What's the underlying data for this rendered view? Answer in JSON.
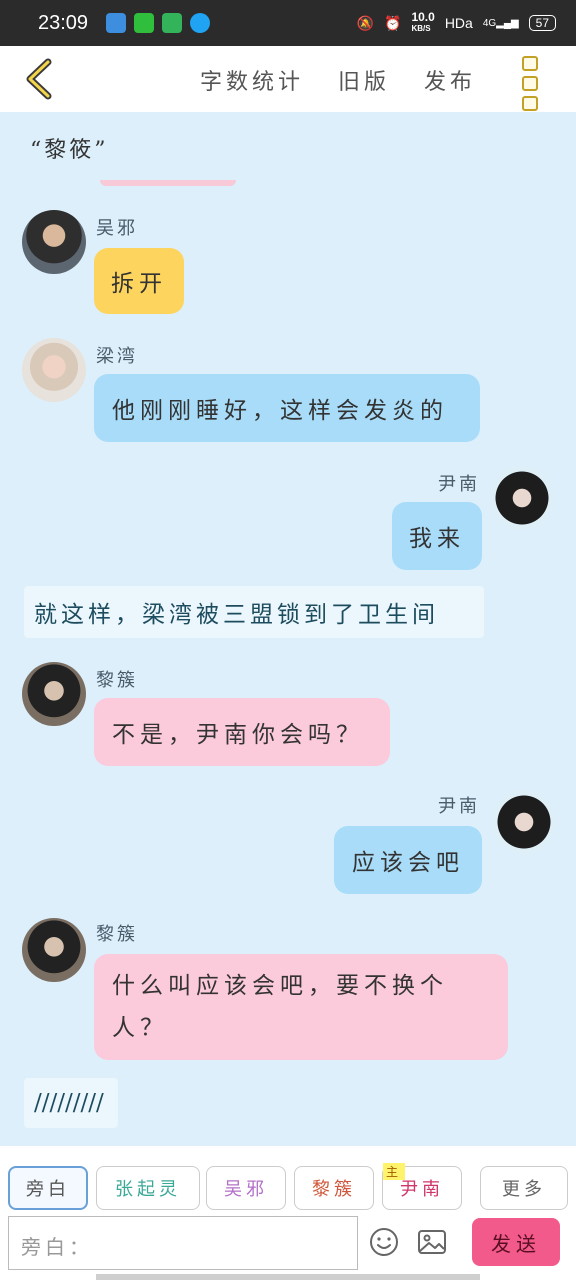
{
  "status": {
    "time": "23:09",
    "speed": "10.0",
    "speed_unit": "KB/S",
    "hd": "HDa",
    "net": "4G",
    "battery": "57"
  },
  "topbar": {
    "word_count": "字数统计",
    "old_version": "旧版",
    "publish": "发布"
  },
  "chat": {
    "quote_line": "“黎筱”",
    "messages": [
      {
        "speaker": "吴邪",
        "text": "拆开"
      },
      {
        "speaker": "梁湾",
        "text": "他刚刚睡好，这样会发炎的"
      },
      {
        "speaker": "尹南",
        "text": "我来"
      },
      {
        "narration": "就这样，梁湾被三盟锁到了卫生间"
      },
      {
        "speaker": "黎簇",
        "text": "不是，尹南你会吗？"
      },
      {
        "speaker": "尹南",
        "text": "应该会吧"
      },
      {
        "speaker": "黎簇",
        "text_line1": "什么叫应该会吧，要不换个",
        "text_line2": "人？"
      },
      {
        "narration": "/////////"
      }
    ]
  },
  "characters": {
    "narrator": "旁白",
    "c1": "张起灵",
    "c2": "吴邪",
    "c3": "黎簇",
    "c4_tag": "主",
    "c4": "尹南",
    "more": "更多"
  },
  "input": {
    "placeholder": "旁白：",
    "send": "发送"
  },
  "colors": {
    "yellow": "#fdd45d",
    "blue": "#a8dcf9",
    "pink": "#fbcadb",
    "send": "#f25a8b",
    "accent_back": "#c4a126"
  }
}
